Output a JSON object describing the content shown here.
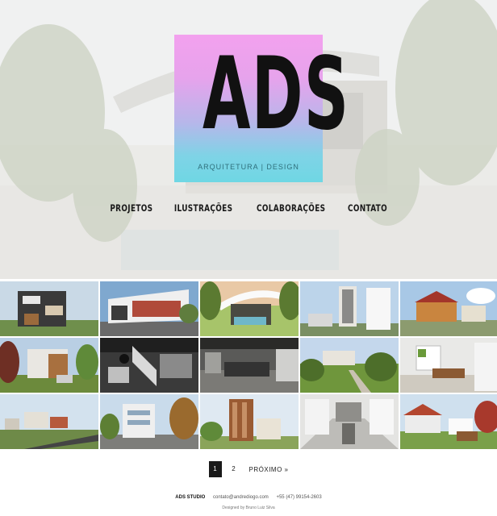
{
  "logo": {
    "mark": "ADS",
    "subtitle": "ARQUITETURA | DESIGN"
  },
  "nav": {
    "items": [
      "PROJETOS",
      "ILUSTRAÇÕES",
      "COLABORAÇÕES",
      "CONTATO"
    ]
  },
  "gallery": {
    "items": [
      {
        "name": "project-thumb-1"
      },
      {
        "name": "project-thumb-2"
      },
      {
        "name": "project-thumb-3"
      },
      {
        "name": "project-thumb-4"
      },
      {
        "name": "project-thumb-5"
      },
      {
        "name": "project-thumb-6"
      },
      {
        "name": "project-thumb-7"
      },
      {
        "name": "project-thumb-8"
      },
      {
        "name": "project-thumb-9"
      },
      {
        "name": "project-thumb-10"
      },
      {
        "name": "project-thumb-11"
      },
      {
        "name": "project-thumb-12"
      },
      {
        "name": "project-thumb-13"
      },
      {
        "name": "project-thumb-14"
      },
      {
        "name": "project-thumb-15"
      }
    ]
  },
  "pagination": {
    "current": "1",
    "page2": "2",
    "next": "PRÓXIMO »"
  },
  "footer": {
    "brand": "ADS STUDIO",
    "email": "contato@andrediogo.com",
    "phone": "+55 (47) 99154-2603",
    "credit": "Designed by Bruno Luiz Silva"
  },
  "colors": {
    "logo_top": "#f3a1ee",
    "logo_bottom": "#6fd7e4",
    "text_dark": "#1a1a1a"
  }
}
